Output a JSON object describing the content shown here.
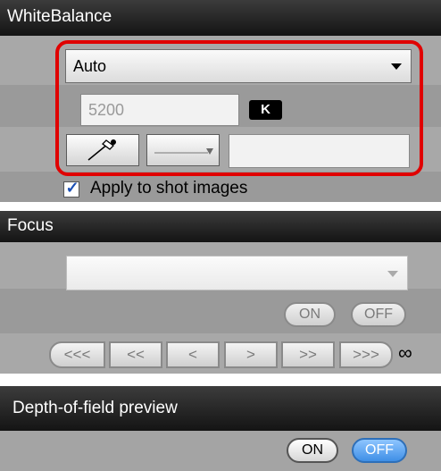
{
  "white_balance": {
    "title": "WhiteBalance",
    "mode_selected": "Auto",
    "kelvin_value": "5200",
    "kelvin_unit": "K",
    "apply_label": "Apply to shot images",
    "apply_checked": true
  },
  "focus": {
    "title": "Focus",
    "af_select_value": "",
    "on_label": "ON",
    "off_label": "OFF",
    "buttons": [
      "<<<",
      "<<",
      "<",
      ">",
      ">>",
      ">>>"
    ],
    "infinity": "∞"
  },
  "dof": {
    "title": "Depth-of-field preview",
    "on_label": "ON",
    "off_label": "OFF",
    "active": "OFF"
  },
  "colors": {
    "highlight": "#e00000",
    "active_button": "#3f8fe6"
  }
}
